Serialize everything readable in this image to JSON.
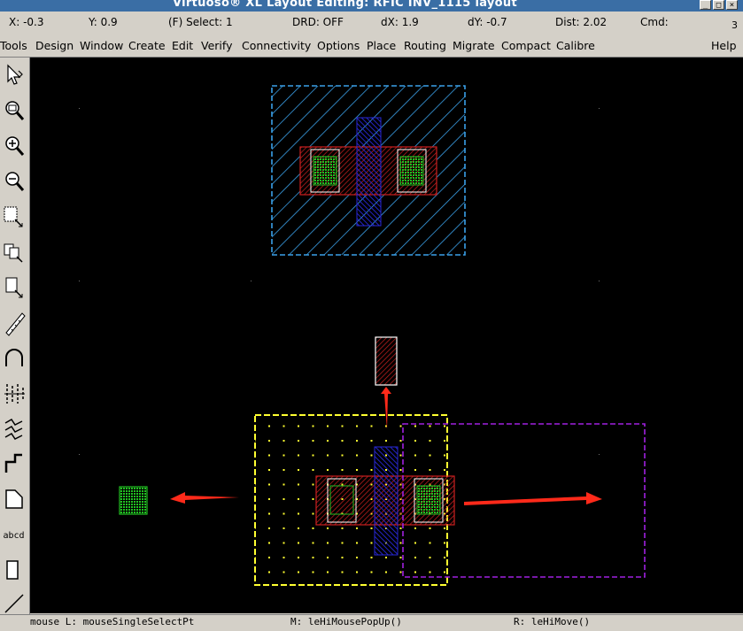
{
  "window": {
    "title": "Virtuoso® XL Layout Editing: RFIC INV_1115 layout",
    "controls": [
      "_",
      "□",
      "×"
    ]
  },
  "status": {
    "x": "X: -0.3",
    "y": "Y: 0.9",
    "select": "(F) Select: 1",
    "drd": "DRD: OFF",
    "dx": "dX: 1.9",
    "dy": "dY: -0.7",
    "dist": "Dist: 2.02",
    "cmd": "Cmd:",
    "count": "3"
  },
  "menu": {
    "items": [
      "Tools",
      "Design",
      "Window",
      "Create",
      "Edit",
      "Verify",
      "Connectivity",
      "Options",
      "Place",
      "Routing",
      "Migrate",
      "Compact",
      "Calibre"
    ],
    "help": "Help"
  },
  "toolbar": {
    "icons": [
      "cursor-arrow-icon",
      "zoom-fit-icon",
      "zoom-in-icon",
      "zoom-out-icon",
      "stretch-icon",
      "copy-icon",
      "move-icon",
      "ruler-icon",
      "arc-icon",
      "wire-icon",
      "path-icon",
      "step-icon",
      "polygon-icon",
      "label-icon",
      "rectangle-icon",
      "line-icon"
    ],
    "label_text": "abcd"
  },
  "bottom": {
    "left": "mouse L: mouseSingleSelectPt",
    "middle": "M: leHiMousePopUp()",
    "right": "R: leHiMove()"
  },
  "colors": {
    "nwell": "#3aa0e8",
    "poly": "#cc2020",
    "metal1": "#2020cc",
    "contact": "#20c020",
    "highlight": "#ffff30",
    "ghost": "#a020e0",
    "arrow": "#ff2a1a"
  }
}
